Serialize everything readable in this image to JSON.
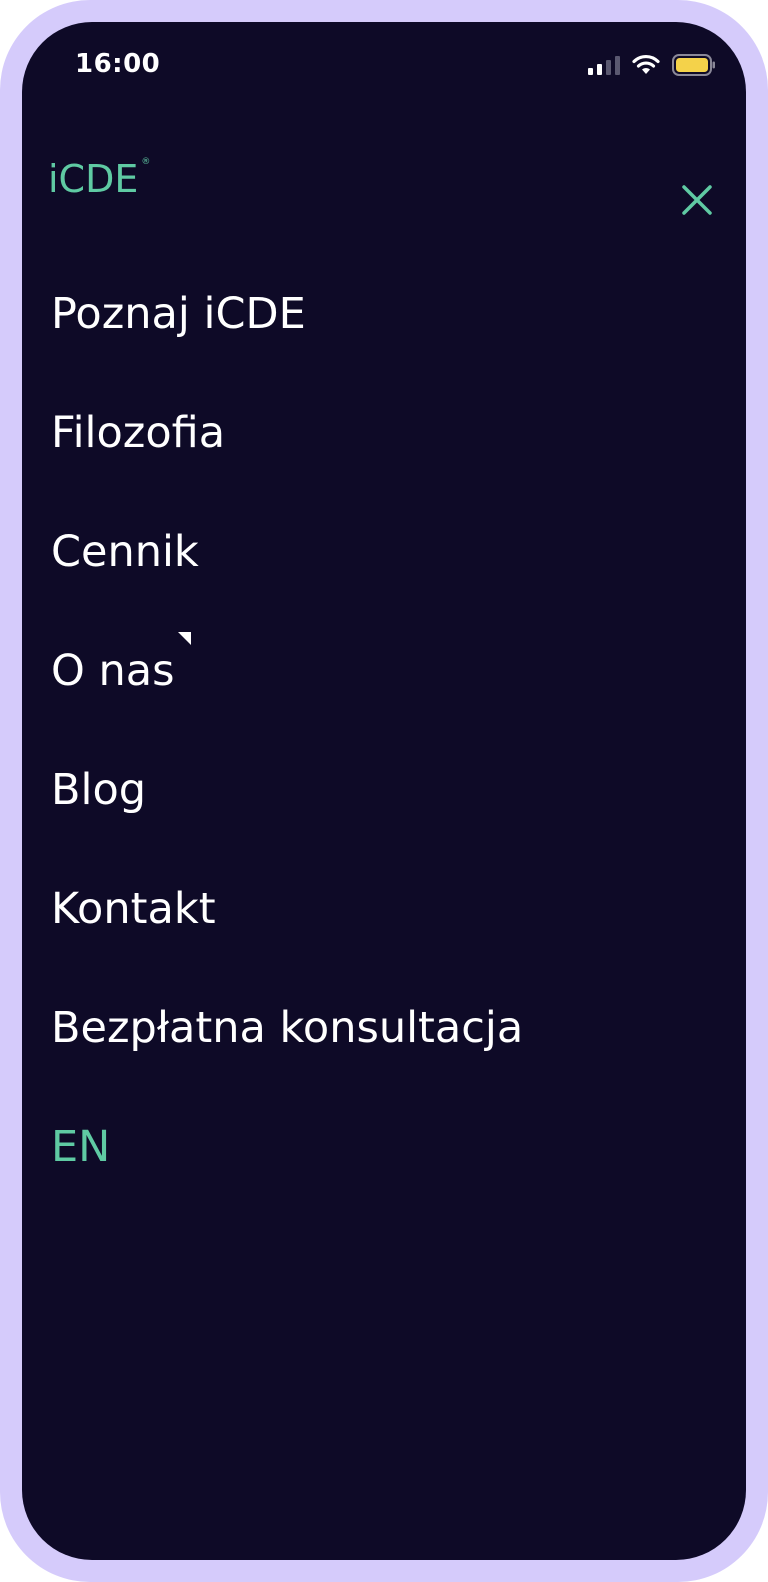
{
  "status_bar": {
    "time": "16:00",
    "battery_color": "#f4d24a"
  },
  "header": {
    "logo_text": "iCDE",
    "logo_mark": "®",
    "close_icon": "close-icon"
  },
  "menu": {
    "items": [
      {
        "label": "Poznaj iCDE"
      },
      {
        "label": "Filozofia"
      },
      {
        "label": "Cennik"
      },
      {
        "label": "O nas"
      },
      {
        "label": "Blog"
      },
      {
        "label": "Kontakt"
      },
      {
        "label": "Bezpłatna konsultacja"
      },
      {
        "label": "EN"
      }
    ]
  },
  "colors": {
    "frame": "#d5cbfb",
    "background": "#0e0a27",
    "accent": "#5fcaa3",
    "text": "#ffffff"
  }
}
